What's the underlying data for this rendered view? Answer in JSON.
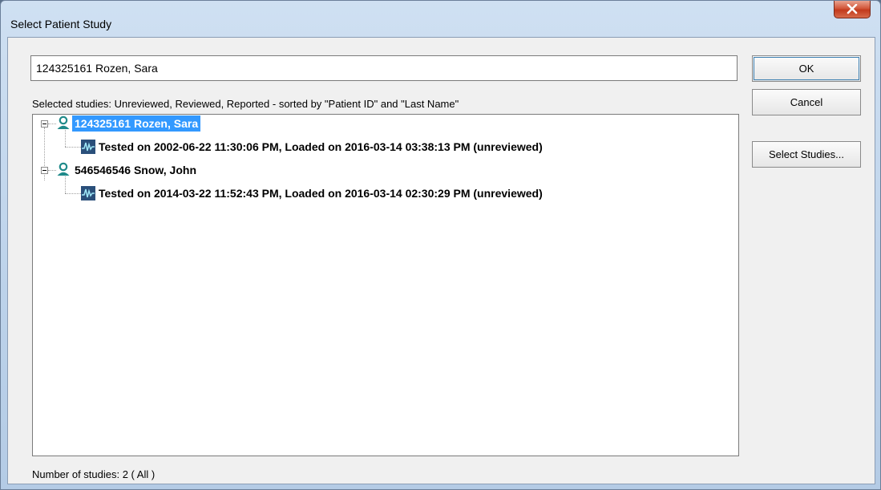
{
  "window": {
    "title": "Select Patient Study"
  },
  "search": {
    "value": "124325161 Rozen, Sara"
  },
  "info_text": "Selected studies:  Unreviewed, Reviewed, Reported - sorted by \"Patient ID\" and \"Last Name\"",
  "tree": {
    "patients": [
      {
        "label": "124325161 Rozen, Sara",
        "selected": true,
        "studies": [
          {
            "label": "Tested on 2002-06-22 11:30:06 PM, Loaded on 2016-03-14 03:38:13 PM (unreviewed)"
          }
        ]
      },
      {
        "label": "546546546 Snow, John",
        "selected": false,
        "studies": [
          {
            "label": "Tested on 2014-03-22 11:52:43 PM, Loaded on 2016-03-14 02:30:29 PM (unreviewed)"
          }
        ]
      }
    ]
  },
  "buttons": {
    "ok": "OK",
    "cancel": "Cancel",
    "select_studies": "Select Studies..."
  },
  "status": "Number of studies: 2 ( All )",
  "icons": {
    "patient": "person-icon",
    "study": "waveform-icon",
    "close": "close-icon"
  },
  "colors": {
    "selection": "#3399ff",
    "close_button": "#c9472a",
    "patient_icon": "#1f8a8a",
    "study_icon": "#2a4f7a"
  }
}
